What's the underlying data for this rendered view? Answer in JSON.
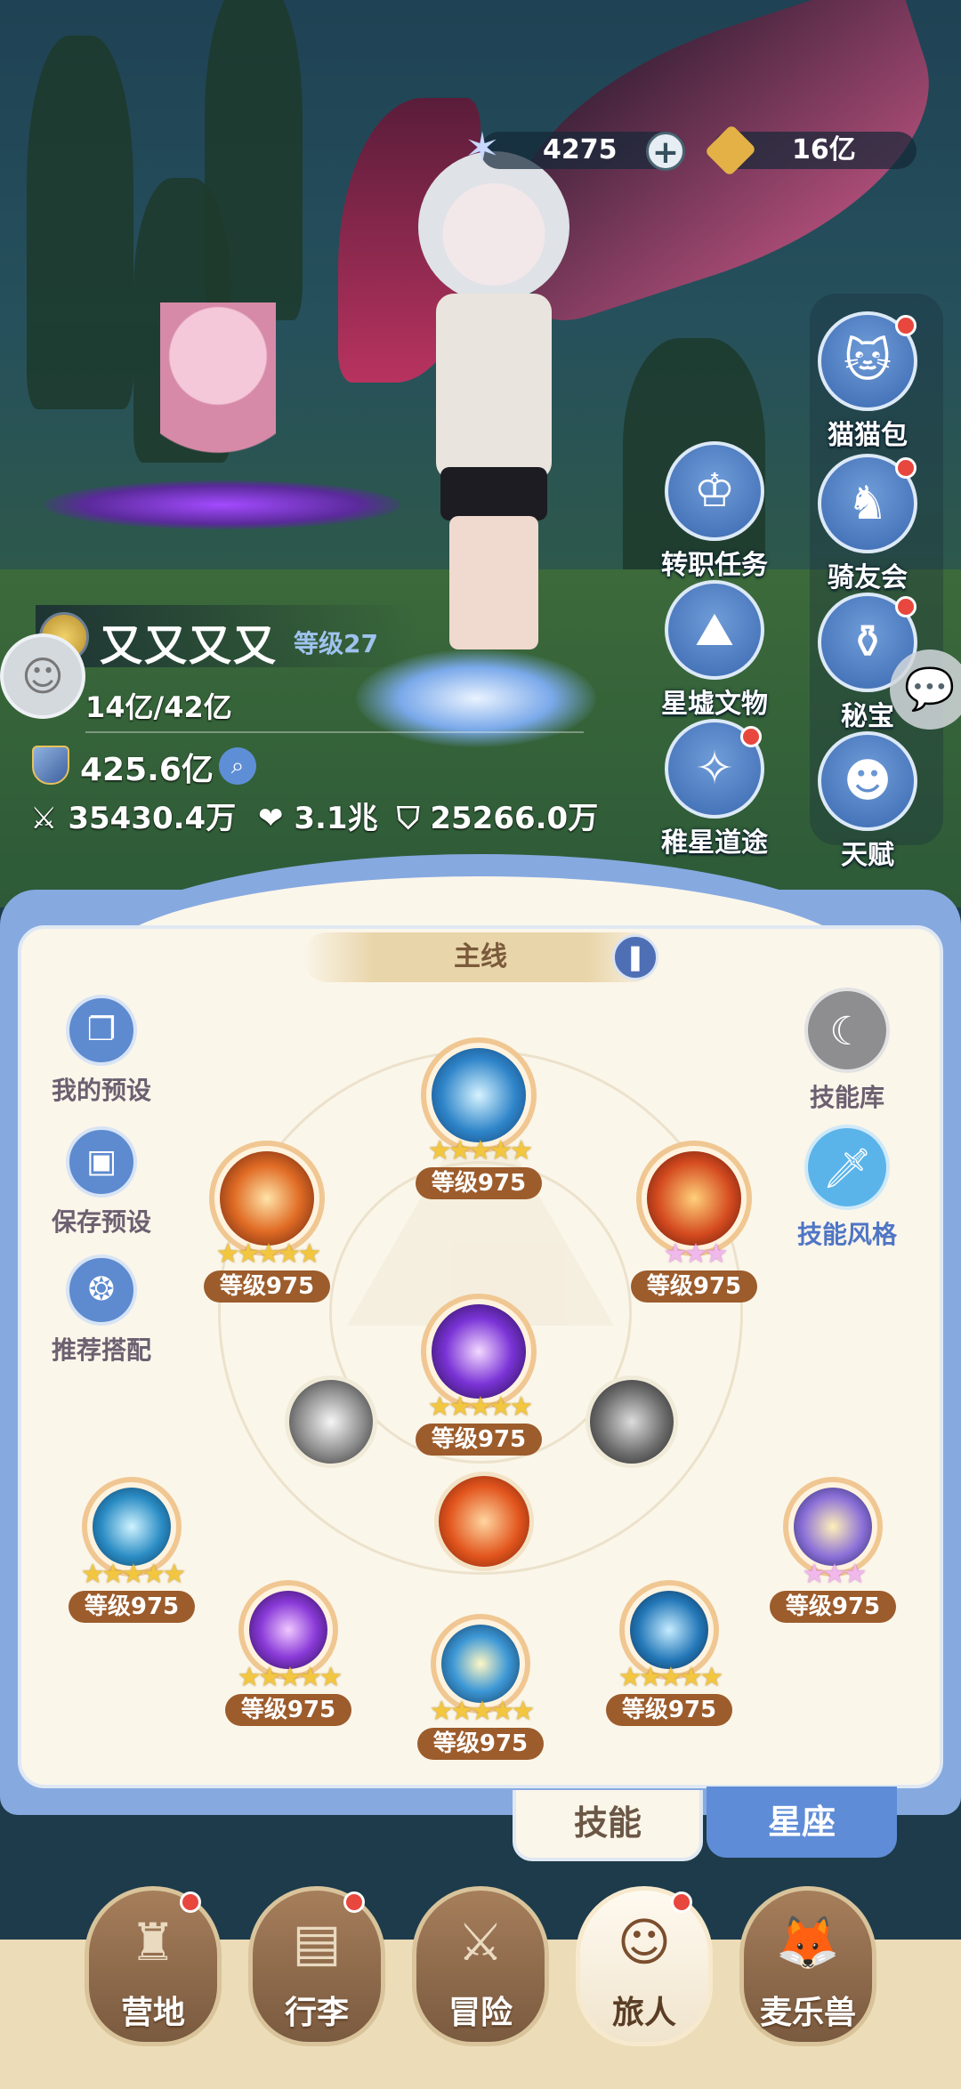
{
  "currency": {
    "star_amount": "4275",
    "gold_amount": "16亿"
  },
  "side_menu": [
    {
      "label": "猫猫包",
      "icon": "cat-bag-icon",
      "dot": true
    },
    {
      "label": "转职任务",
      "icon": "crown-icon",
      "dot": false
    },
    {
      "label": "骑友会",
      "icon": "horse-icon",
      "dot": true
    },
    {
      "label": "星墟文物",
      "icon": "ruins-icon",
      "dot": false
    },
    {
      "label": "秘宝",
      "icon": "treasure-icon",
      "dot": true
    },
    {
      "label": "稚星道途",
      "icon": "path-icon",
      "dot": true
    },
    {
      "label": "天赋",
      "icon": "talent-head-icon",
      "dot": false
    }
  ],
  "player": {
    "name": "又又又又",
    "level": "等级27",
    "exp": "14亿/42亿",
    "power": "425.6亿",
    "attack": "35430.4万",
    "hp": "3.1兆",
    "defense": "25266.0万"
  },
  "panel": {
    "title": "主线",
    "left_buttons": [
      "我的预设",
      "保存预设",
      "推荐搭配"
    ],
    "right_buttons": [
      "技能库",
      "技能风格"
    ]
  },
  "skills": {
    "top": "等级975",
    "upper_left": "等级975",
    "upper_right": "等级975",
    "center": "等级975",
    "mid_left": "等级975",
    "mid_right": "等级975",
    "low_left": "等级975",
    "low_center": "等级975",
    "low_right": "等级975"
  },
  "tabs": {
    "skill": "技能",
    "constellation": "星座"
  },
  "nav": [
    "营地",
    "行李",
    "冒险",
    "旅人",
    "麦乐兽"
  ],
  "colors": {
    "accent_blue": "#5f8cd7",
    "level_badge": "#9c5c2c",
    "star_gold": "#f3c63f",
    "star_pink": "#f1b8ec",
    "notification_red": "#e8473e"
  }
}
